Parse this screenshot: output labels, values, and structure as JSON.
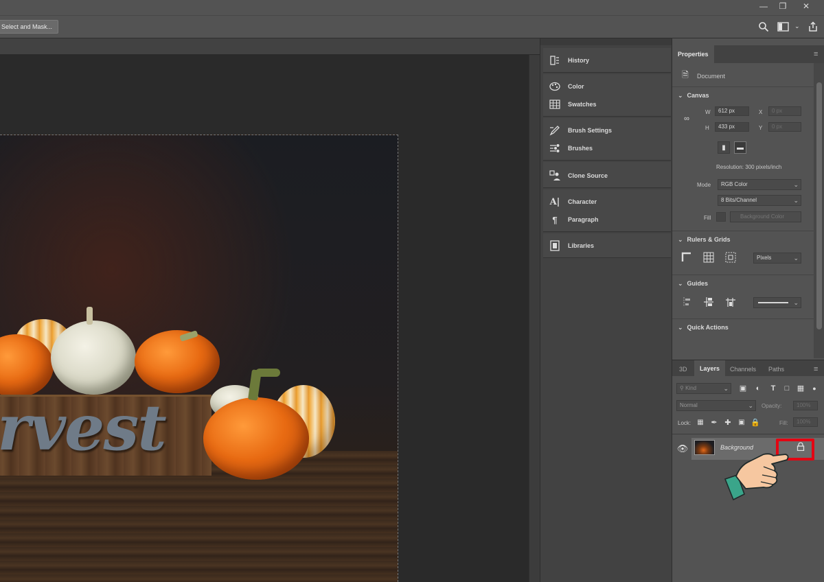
{
  "options_bar": {
    "select_and_mask_label": "Select and Mask..."
  },
  "canvas": {
    "image_text": "rvest"
  },
  "mid_panel": {
    "items": [
      {
        "label": "History",
        "icon": "history-icon"
      },
      {
        "label": "Color",
        "icon": "color-palette-icon"
      },
      {
        "label": "Swatches",
        "icon": "swatches-grid-icon"
      },
      {
        "label": "Brush Settings",
        "icon": "brush-settings-icon"
      },
      {
        "label": "Brushes",
        "icon": "brushes-icon"
      },
      {
        "label": "Clone Source",
        "icon": "clone-source-icon"
      },
      {
        "label": "Character",
        "icon": "character-icon"
      },
      {
        "label": "Paragraph",
        "icon": "paragraph-icon"
      },
      {
        "label": "Libraries",
        "icon": "libraries-icon"
      }
    ]
  },
  "properties": {
    "tab_label": "Properties",
    "document_label": "Document",
    "canvas_section": "Canvas",
    "w_label": "W",
    "w_value": "612 px",
    "h_label": "H",
    "h_value": "433 px",
    "x_label": "X",
    "x_value": "0 px",
    "y_label": "Y",
    "y_value": "0 px",
    "resolution": "Resolution: 300 pixels/inch",
    "mode_label": "Mode",
    "mode_value": "RGB Color",
    "bit_depth_value": "8 Bits/Channel",
    "fill_label": "Fill",
    "fill_value": "Background Color",
    "rulers_section": "Rulers & Grids",
    "units_value": "Pixels",
    "guides_section": "Guides",
    "quick_actions_section": "Quick Actions"
  },
  "layers_panel": {
    "tabs": [
      "3D",
      "Layers",
      "Channels",
      "Paths"
    ],
    "active_tab": "Layers",
    "filter_kind": "Kind",
    "blend_mode": "Normal",
    "opacity_label": "Opacity:",
    "opacity_value": "100%",
    "lock_label": "Lock:",
    "fill_label": "Fill:",
    "fill_value": "100%",
    "layers": [
      {
        "name": "Background",
        "visible": true,
        "locked": true
      }
    ]
  },
  "colors": {
    "highlight": "#e30613",
    "panel_bg": "#535353",
    "canvas_bg": "#2a2a2a"
  }
}
